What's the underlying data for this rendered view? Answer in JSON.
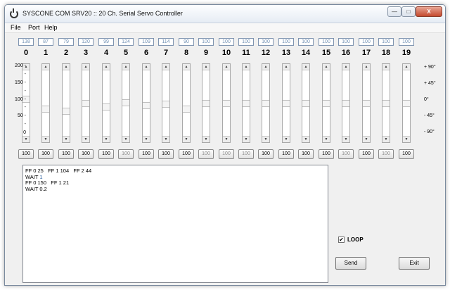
{
  "window": {
    "title": "SYSCONE COM  SRV20  ::  20 Ch. Serial Servo Controller"
  },
  "titlebar_buttons": {
    "minimize": "—",
    "maximize": "□",
    "close": "X"
  },
  "menu": [
    "File",
    "Port",
    "Help"
  ],
  "channels": [
    {
      "label": "0",
      "position": "138",
      "value": "100",
      "value_enabled": true,
      "level": 0.57
    },
    {
      "label": "1",
      "position": "87",
      "value": "100",
      "value_enabled": true,
      "level": 0.39
    },
    {
      "label": "2",
      "position": "79",
      "value": "100",
      "value_enabled": true,
      "level": 0.36
    },
    {
      "label": "3",
      "position": "120",
      "value": "100",
      "value_enabled": true,
      "level": 0.49
    },
    {
      "label": "4",
      "position": "99",
      "value": "100",
      "value_enabled": true,
      "level": 0.43
    },
    {
      "label": "5",
      "position": "124",
      "value": "100",
      "value_enabled": false,
      "level": 0.51
    },
    {
      "label": "6",
      "position": "109",
      "value": "100",
      "value_enabled": true,
      "level": 0.46
    },
    {
      "label": "7",
      "position": "114",
      "value": "100",
      "value_enabled": true,
      "level": 0.48
    },
    {
      "label": "8",
      "position": "90",
      "value": "100",
      "value_enabled": true,
      "level": 0.4
    },
    {
      "label": "9",
      "position": "100",
      "value": "100",
      "value_enabled": false,
      "level": 0.5
    },
    {
      "label": "10",
      "position": "100",
      "value": "100",
      "value_enabled": false,
      "level": 0.5
    },
    {
      "label": "11",
      "position": "100",
      "value": "100",
      "value_enabled": false,
      "level": 0.5
    },
    {
      "label": "12",
      "position": "100",
      "value": "100",
      "value_enabled": true,
      "level": 0.5
    },
    {
      "label": "13",
      "position": "100",
      "value": "100",
      "value_enabled": true,
      "level": 0.5
    },
    {
      "label": "14",
      "position": "100",
      "value": "100",
      "value_enabled": true,
      "level": 0.5
    },
    {
      "label": "15",
      "position": "100",
      "value": "100",
      "value_enabled": true,
      "level": 0.5
    },
    {
      "label": "16",
      "position": "100",
      "value": "100",
      "value_enabled": false,
      "level": 0.5
    },
    {
      "label": "17",
      "position": "100",
      "value": "100",
      "value_enabled": true,
      "level": 0.5
    },
    {
      "label": "18",
      "position": "100",
      "value": "100",
      "value_enabled": false,
      "level": 0.5
    },
    {
      "label": "19",
      "position": "100",
      "value": "100",
      "value_enabled": true,
      "level": 0.5
    }
  ],
  "scale_left": [
    "200 -",
    "-",
    "150 -",
    "-",
    "100 -",
    "-",
    "50 -",
    "-",
    "0"
  ],
  "scale_right": [
    "+ 90°",
    "+ 45°",
    "0°",
    "- 45°",
    "- 90°"
  ],
  "script": [
    [
      {
        "t": "FF 0 25   FF 1 104   FF 2 44"
      }
    ],
    [
      {
        "t": "WAIT "
      },
      {
        "t": "1",
        "hl": true
      }
    ],
    [
      {
        "t": "FF 0 150   FF 1 21"
      }
    ],
    [
      {
        "t": "WAIT 0.2"
      }
    ]
  ],
  "loop": {
    "label": "LOOP",
    "checked": true,
    "check_mark": "✔"
  },
  "buttons": {
    "send": "Send",
    "exit": "Exit"
  },
  "colors": {
    "position_text": "#6e8fb3",
    "disabled_value": "#8a8a8a",
    "script_highlight": "#2b5f9e"
  }
}
